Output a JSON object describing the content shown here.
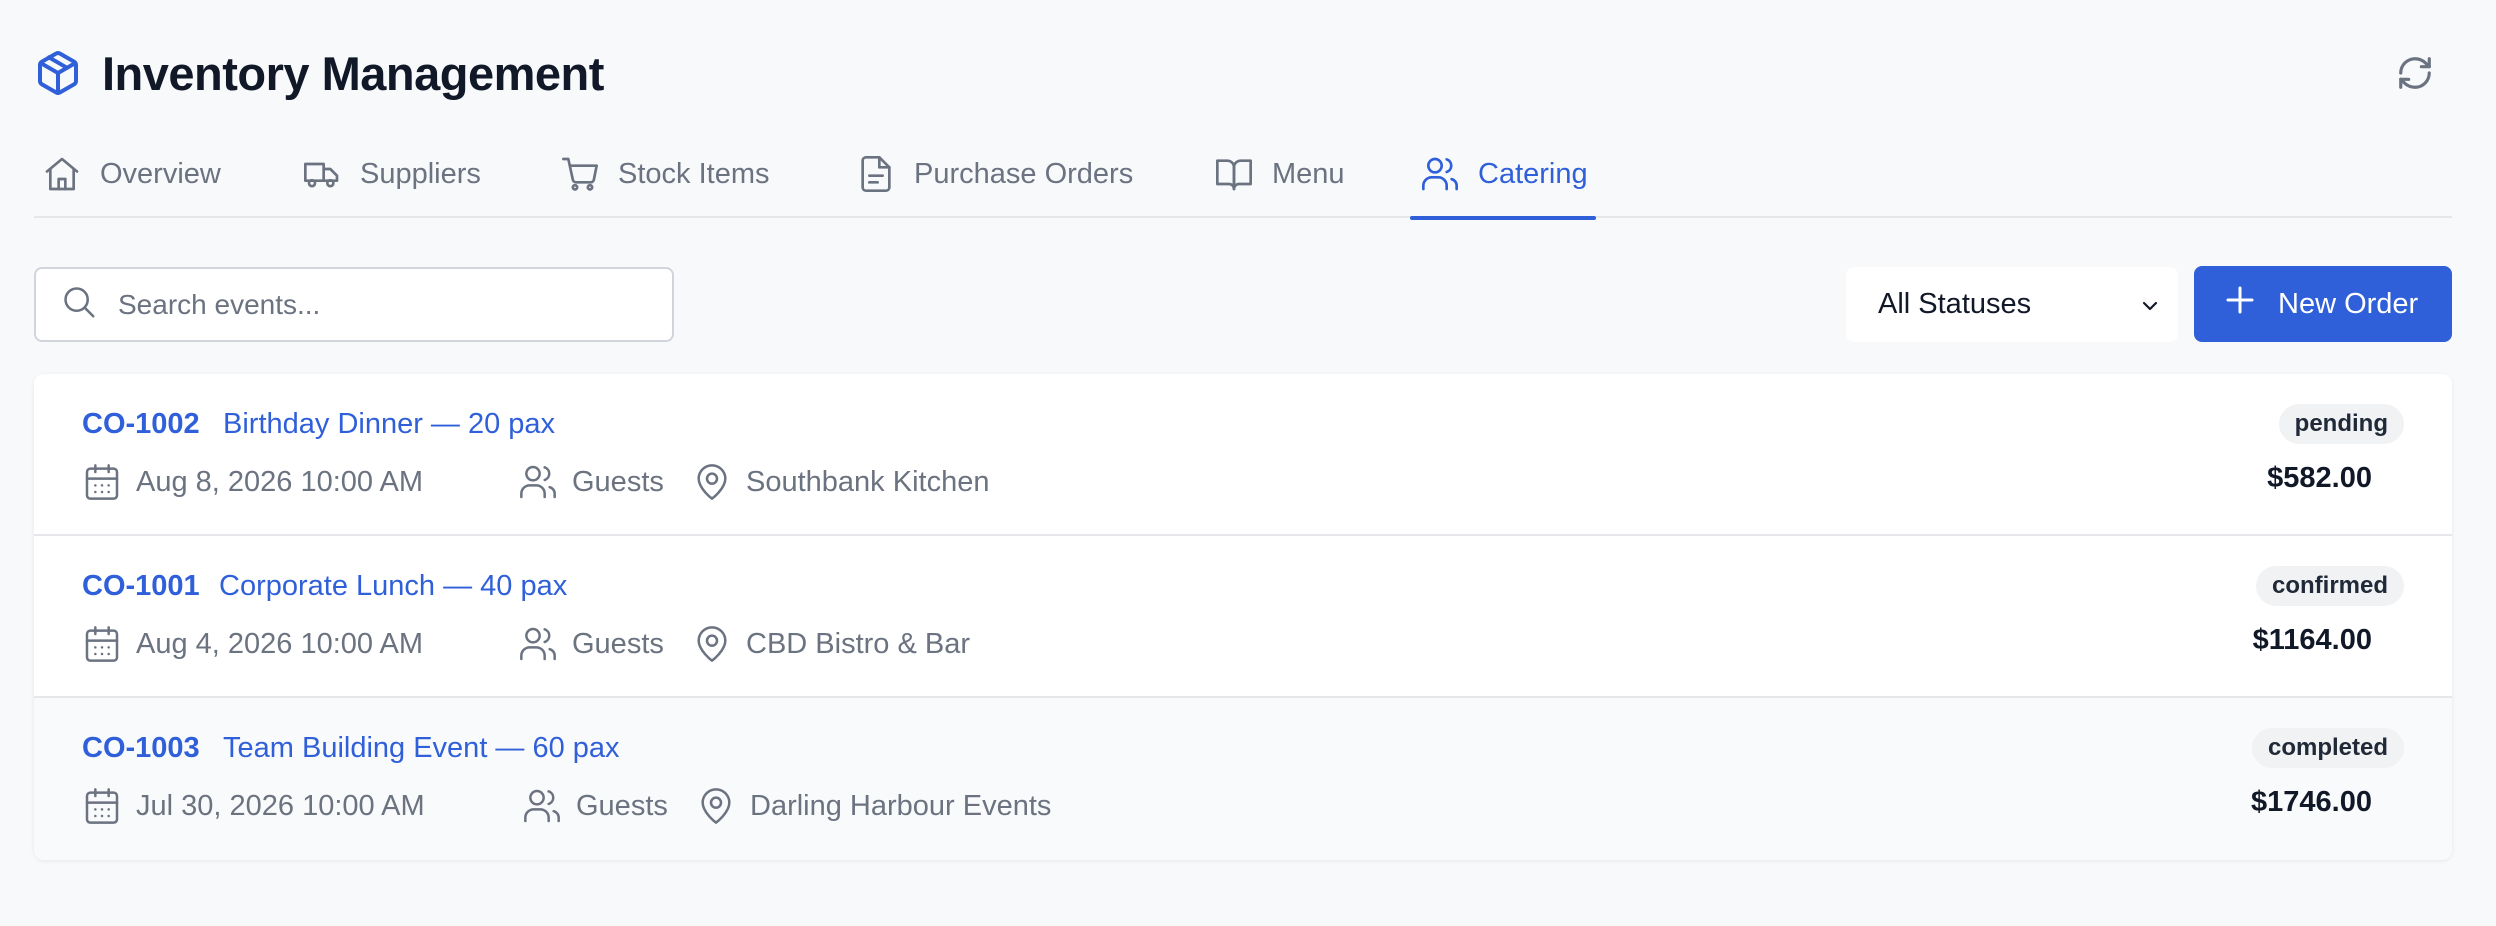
{
  "header": {
    "title": "Inventory Management",
    "logo_icon": "package-icon",
    "refresh_icon": "refresh-icon"
  },
  "tabs": [
    {
      "label": "Overview",
      "icon": "home-icon"
    },
    {
      "label": "Suppliers",
      "icon": "truck-icon"
    },
    {
      "label": "Stock Items",
      "icon": "cart-icon"
    },
    {
      "label": "Purchase Orders",
      "icon": "document-icon"
    },
    {
      "label": "Menu",
      "icon": "book-icon"
    },
    {
      "label": "Catering",
      "icon": "users-icon",
      "active": true
    }
  ],
  "toolbar": {
    "search_placeholder": "Search events...",
    "status_filter": "All Statuses",
    "new_order_label": "New Order"
  },
  "orders": [
    {
      "id": "CO-1002",
      "name": "Birthday Dinner — 20 pax",
      "date": "Aug 8, 2026 10:00 AM",
      "guests": "Guests",
      "venue": "Southbank Kitchen",
      "status": "pending",
      "amount": "$582.00"
    },
    {
      "id": "CO-1001",
      "name": "Corporate Lunch — 40 pax",
      "date": "Aug 4, 2026 10:00 AM",
      "guests": "Guests",
      "venue": "CBD Bistro & Bar",
      "status": "confirmed",
      "amount": "$1164.00"
    },
    {
      "id": "CO-1003",
      "name": "Team Building Event — 60 pax",
      "date": "Jul 30, 2026 10:00 AM",
      "guests": "Guests",
      "venue": "Darling Harbour Events",
      "status": "completed",
      "amount": "$1746.00"
    }
  ],
  "colors": {
    "accent": "#2f5fd9",
    "muted": "#6b7280",
    "border": "#e5e7eb",
    "background": "#f8f9fb"
  }
}
